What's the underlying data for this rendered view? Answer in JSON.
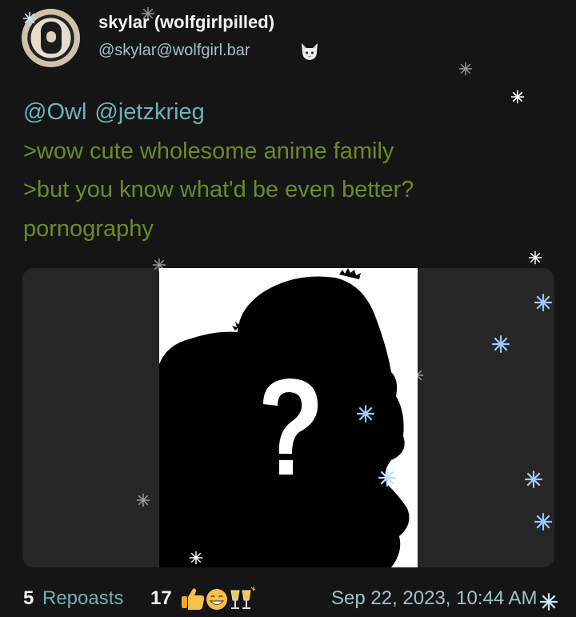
{
  "author": {
    "display_name": "skylar (wolfgirlpilled)",
    "handle": "@skylar@wolfgirl.bar"
  },
  "post": {
    "mentions": [
      "@Owl",
      "@jetzkrieg"
    ],
    "greentext_lines": [
      ">wow cute wholesome anime family",
      ">but you know what'd be even better?"
    ],
    "text": "pornography"
  },
  "footer": {
    "repost_count": "5",
    "repost_label": "Repoasts",
    "reaction_count": "17",
    "reaction_icons": [
      "thumbs-up-emoji",
      "grinning-emoji",
      "clinking-glasses-emoji"
    ],
    "timestamp": "Sep 22, 2023, 10:44 AM"
  },
  "colors": {
    "background": "#151515",
    "mention": "#6fb2b6",
    "greentext": "#6b8a2c",
    "handle": "#9fc3c8",
    "media_background": "#262626"
  }
}
